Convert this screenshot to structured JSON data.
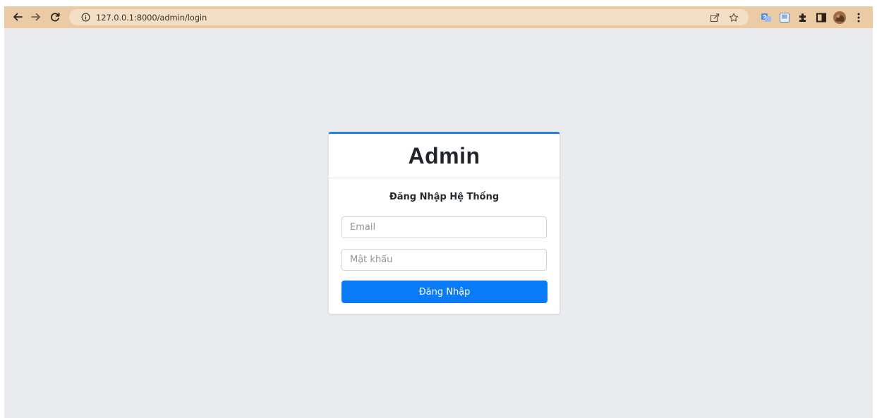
{
  "browser": {
    "url": "127.0.0.1:8000/admin/login",
    "nav_icons": [
      "back-icon",
      "forward-icon",
      "reload-icon",
      "info-icon"
    ],
    "toolbar_icons": [
      "share-icon",
      "bookmark-star-icon",
      "extension-translate-icon",
      "extension-screenshot-icon",
      "extensions-puzzle-icon",
      "side-panel-icon",
      "profile-avatar-icon",
      "menu-kebab-icon"
    ],
    "colors": {
      "toolbar": "#ebcba5",
      "omnibox": "#f3dfc6"
    }
  },
  "login": {
    "brand": "Admin",
    "subtitle": "Đăng Nhập Hệ Thống",
    "email_placeholder": "Email",
    "password_placeholder": "Mật khẩu",
    "submit_label": "Đăng Nhập",
    "colors": {
      "page_background": "#e9ebee",
      "card_top_border": "#2a7ee7",
      "button": "#0a7bf7"
    }
  }
}
